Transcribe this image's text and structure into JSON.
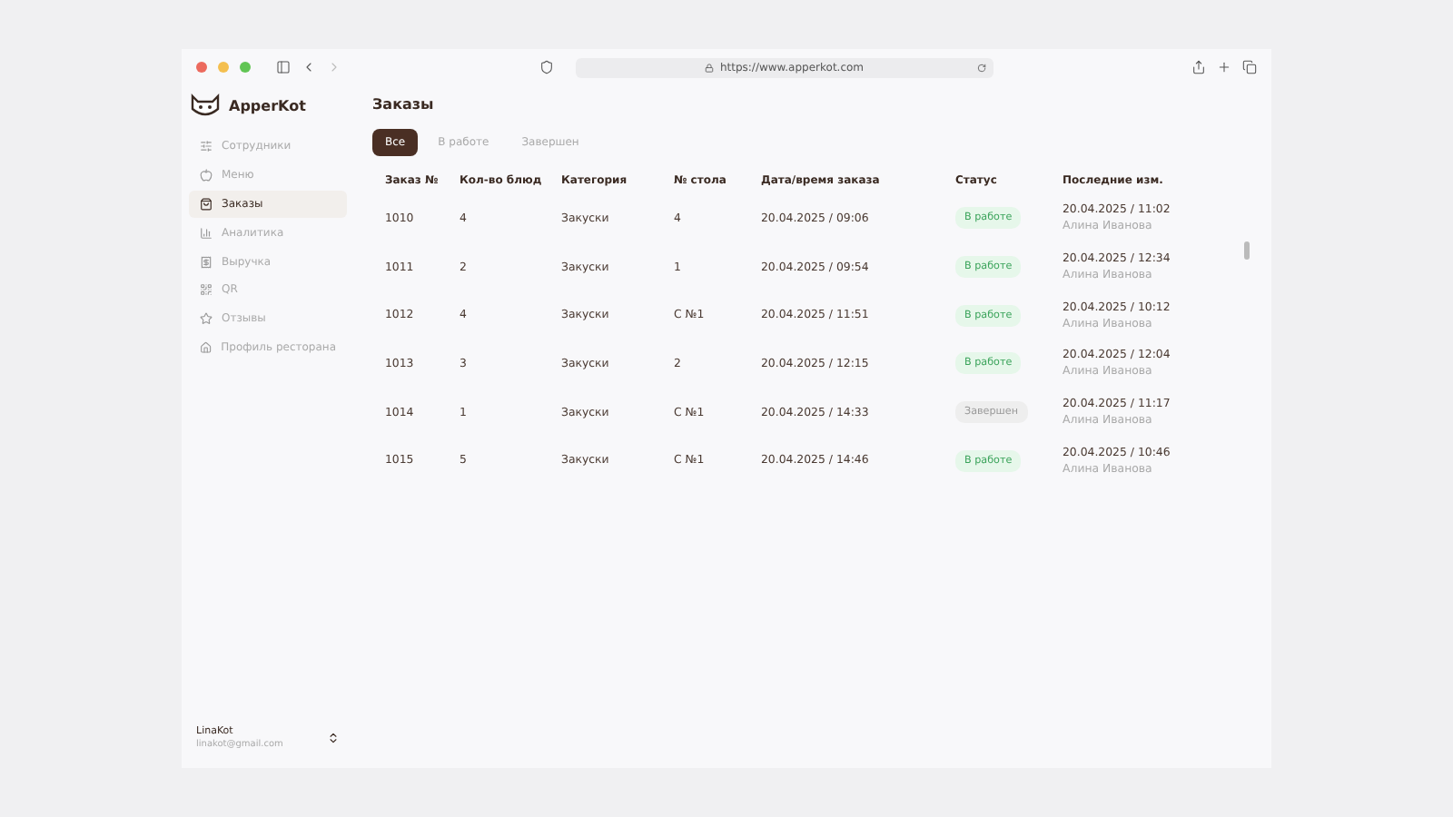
{
  "browser": {
    "url": "https://www.apperkot.com"
  },
  "brand": {
    "name": "ApperKot"
  },
  "sidebar": {
    "items": [
      {
        "label": "Сотрудники",
        "selected": false
      },
      {
        "label": "Меню",
        "selected": false
      },
      {
        "label": "Заказы",
        "selected": true
      },
      {
        "label": "Аналитика",
        "selected": false
      },
      {
        "label": "Выручка",
        "selected": false
      },
      {
        "label": "QR",
        "selected": false
      },
      {
        "label": "Отзывы",
        "selected": false
      },
      {
        "label": "Профиль ресторана",
        "selected": false
      }
    ]
  },
  "user": {
    "name": "LinaKot",
    "email": "linakot@gmail.com"
  },
  "page": {
    "title": "Заказы"
  },
  "tabs": [
    {
      "label": "Все",
      "selected": true
    },
    {
      "label": "В работе",
      "selected": false
    },
    {
      "label": "Завершен",
      "selected": false
    }
  ],
  "table": {
    "columns": [
      "Заказ №",
      "Кол-во блюд",
      "Категория",
      "№ стола",
      "Дата/время заказа",
      "Статус",
      "Последние изм."
    ],
    "rows": [
      {
        "order": "1010",
        "count": "4",
        "category": "Закуски",
        "table": "4",
        "date": "20.04.2025 / 09:06",
        "status": {
          "label": "В работе",
          "kind": "active"
        },
        "changed": "20.04.2025 / 11:02",
        "by": "Алина Иванова"
      },
      {
        "order": "1011",
        "count": "2",
        "category": "Закуски",
        "table": "1",
        "date": "20.04.2025 / 09:54",
        "status": {
          "label": "В работе",
          "kind": "active"
        },
        "changed": "20.04.2025 / 12:34",
        "by": "Алина Иванова"
      },
      {
        "order": "1012",
        "count": "4",
        "category": "Закуски",
        "table": "С №1",
        "date": "20.04.2025 / 11:51",
        "status": {
          "label": "В работе",
          "kind": "active"
        },
        "changed": "20.04.2025 / 10:12",
        "by": "Алина Иванова"
      },
      {
        "order": "1013",
        "count": "3",
        "category": "Закуски",
        "table": "2",
        "date": "20.04.2025 / 12:15",
        "status": {
          "label": "В работе",
          "kind": "active"
        },
        "changed": "20.04.2025 / 12:04",
        "by": "Алина Иванова"
      },
      {
        "order": "1014",
        "count": "1",
        "category": "Закуски",
        "table": "С №1",
        "date": "20.04.2025 / 14:33",
        "status": {
          "label": "Завершен",
          "kind": "done"
        },
        "changed": "20.04.2025 / 11:17",
        "by": "Алина Иванова"
      },
      {
        "order": "1015",
        "count": "5",
        "category": "Закуски",
        "table": "С №1",
        "date": "20.04.2025 / 14:46",
        "status": {
          "label": "В работе",
          "kind": "active"
        },
        "changed": "20.04.2025 / 10:46",
        "by": "Алина Иванова"
      }
    ]
  }
}
